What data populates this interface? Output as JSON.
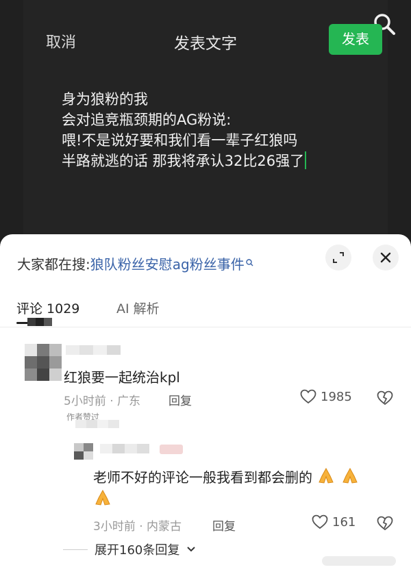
{
  "editor": {
    "cancel_label": "取消",
    "title": "发表文字",
    "publish_label": "发表",
    "text_lines": [
      "身为狼粉的我",
      "会对追竞瓶颈期的AG粉说:",
      "喂!不是说好要和我们看一辈子红狼吗",
      "半路就逃的话 那我将承认32比26强了"
    ],
    "caret_color": "#25b653"
  },
  "sheet": {
    "search_prefix": "大家都在搜:",
    "search_query": "狼队粉丝安慰ag粉丝事件",
    "tabs": [
      {
        "label": "评论 1029"
      },
      {
        "label": "AI 解析"
      }
    ]
  },
  "comments": [
    {
      "text": "红狼要一起统治kpl",
      "time_location": "5小时前 · 广东",
      "reply_label": "回复",
      "likes": "1985",
      "author_badge": "作者赞过"
    },
    {
      "text_line1": "老师不好的评论一般我看到都会删的",
      "time_location": "3小时前 · 内蒙古",
      "reply_label": "回复",
      "likes": "161"
    }
  ],
  "expand_replies_label": "展开160条回复",
  "icons": {
    "top_right": "search-icon",
    "expand": "expand-icon",
    "close": "close-icon",
    "like": "heart-outline-icon",
    "dislike": "broken-heart-icon",
    "emoji": "folded-hands-emoji"
  },
  "colors": {
    "accent_green": "#25b653",
    "link_blue": "#3a63a8"
  }
}
